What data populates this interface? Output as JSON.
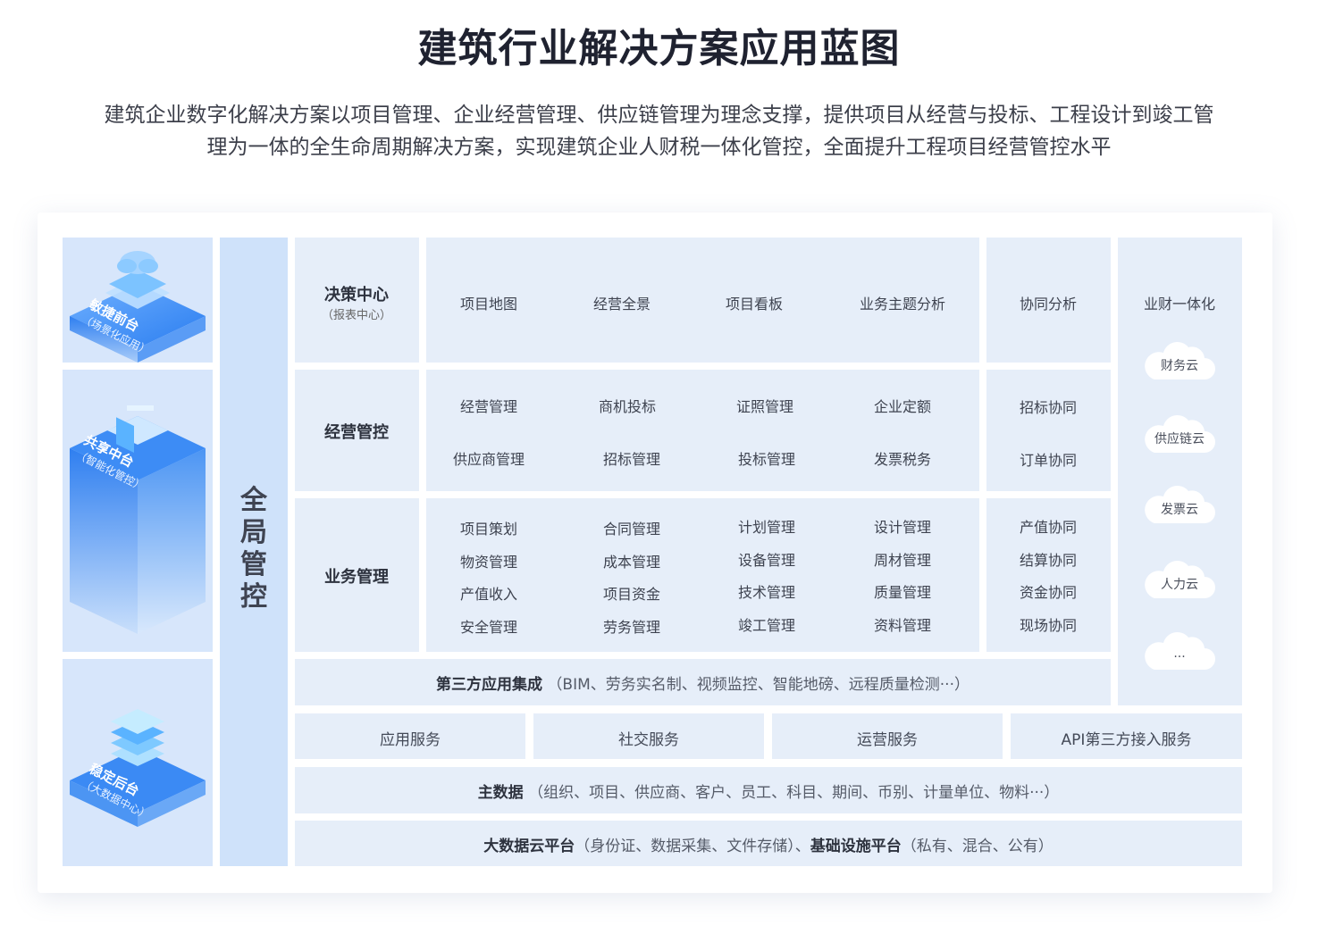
{
  "header": {
    "title": "建筑行业解决方案应用蓝图",
    "subtitle_line1": "建筑企业数字化解决方案以项目管理、企业经营管理、供应链管理为理念支撑，提供项目从经营与投标、工程设计到竣工管",
    "subtitle_line2": "理为一体的全生命周期解决方案，实现建筑企业人财税一体化管控，全面提升工程项目经营管控水平"
  },
  "left_stack": {
    "front": {
      "name": "敏捷前台",
      "sub": "（场景化应用）"
    },
    "middle": {
      "name": "共享中台",
      "sub": "（智能化管控）"
    },
    "back": {
      "name": "稳定后台",
      "sub": "（大数据中心）"
    }
  },
  "global_control": "全局管控",
  "decision": {
    "label": "决策中心",
    "sub": "（报表中心）",
    "items": [
      "项目地图",
      "经营全景",
      "项目看板",
      "业务主题分析"
    ],
    "collab": "协同分析"
  },
  "operation": {
    "label": "经营管控",
    "row1": [
      "经营管理",
      "商机投标",
      "证照管理",
      "企业定额"
    ],
    "row2": [
      "供应商管理",
      "招标管理",
      "投标管理",
      "发票税务"
    ],
    "collab": [
      "招标协同",
      "订单协同"
    ]
  },
  "business": {
    "label": "业务管理",
    "col1": [
      "项目策划",
      "物资管理",
      "产值收入",
      "安全管理"
    ],
    "col2": [
      "合同管理",
      "成本管理",
      "项目资金",
      "劳务管理"
    ],
    "col3": [
      "计划管理",
      "设备管理",
      "技术管理",
      "竣工管理"
    ],
    "col4": [
      "设计管理",
      "周材管理",
      "质量管理",
      "资料管理"
    ],
    "collab": [
      "产值协同",
      "结算协同",
      "资金协同",
      "现场协同"
    ]
  },
  "finance": {
    "label": "业财一体化",
    "clouds": [
      "财务云",
      "供应链云",
      "发票云",
      "人力云",
      "..."
    ]
  },
  "third_party": {
    "label": "第三方应用集成",
    "detail": "（BIM、劳务实名制、视频监控、智能地磅、远程质量检测···）"
  },
  "services": [
    "应用服务",
    "社交服务",
    "运营服务",
    "API第三方接入服务"
  ],
  "master_data": {
    "label": "主数据",
    "detail": "（组织、项目、供应商、客户、员工、科目、期间、币别、计量单位、物料···）"
  },
  "platform": {
    "label1": "大数据云平台",
    "detail1": "（身份证、数据采集、文件存储）、",
    "label2": "基础设施平台",
    "detail2": "（私有、混合、公有）"
  }
}
